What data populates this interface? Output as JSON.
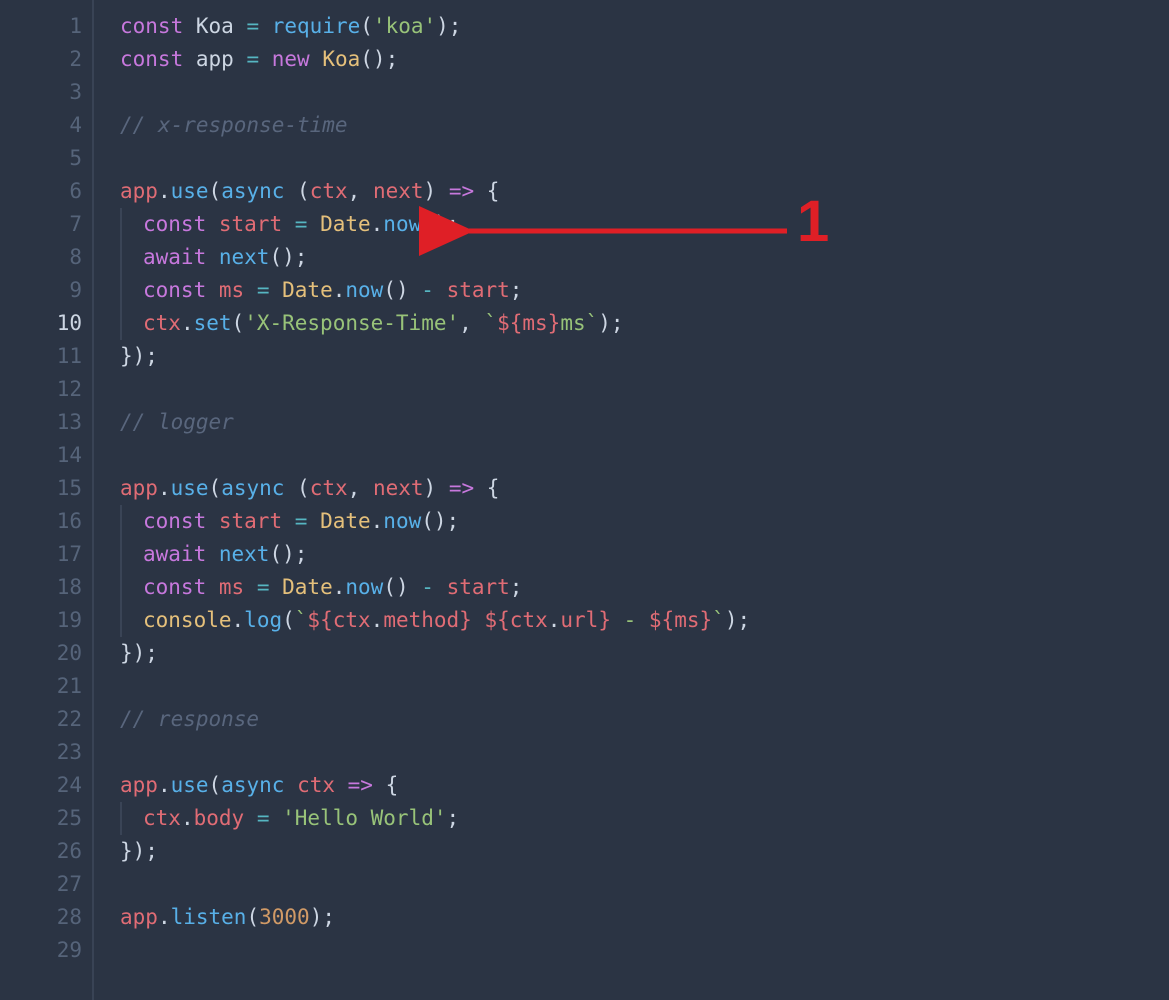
{
  "annotation": {
    "label": "1",
    "color": "#df1f26",
    "target_line": 7
  },
  "line_count": 29,
  "highlight_line_number": 10,
  "code": {
    "lines": [
      {
        "n": 1,
        "tokens": [
          [
            "kw",
            "const"
          ],
          [
            "wd",
            " Koa "
          ],
          [
            "op",
            "="
          ],
          [
            "wd",
            " "
          ],
          [
            "fn",
            "require"
          ],
          [
            "wd",
            "("
          ],
          [
            "str",
            "'koa'"
          ],
          [
            "wd",
            ");"
          ]
        ]
      },
      {
        "n": 2,
        "tokens": [
          [
            "kw",
            "const"
          ],
          [
            "wd",
            " app "
          ],
          [
            "op",
            "="
          ],
          [
            "wd",
            " "
          ],
          [
            "kw",
            "new"
          ],
          [
            "wd",
            " "
          ],
          [
            "cls",
            "Koa"
          ],
          [
            "wd",
            "();"
          ]
        ]
      },
      {
        "n": 3,
        "tokens": []
      },
      {
        "n": 4,
        "tokens": [
          [
            "cmt",
            "// x-response-time"
          ]
        ]
      },
      {
        "n": 5,
        "tokens": []
      },
      {
        "n": 6,
        "tokens": [
          [
            "var",
            "app"
          ],
          [
            "wd",
            "."
          ],
          [
            "fn",
            "use"
          ],
          [
            "wd",
            "("
          ],
          [
            "fn",
            "async"
          ],
          [
            "wd",
            " ("
          ],
          [
            "prm",
            "ctx"
          ],
          [
            "wd",
            ", "
          ],
          [
            "prm",
            "next"
          ],
          [
            "wd",
            ") "
          ],
          [
            "kw",
            "=>"
          ],
          [
            "wd",
            " {"
          ]
        ]
      },
      {
        "n": 7,
        "indent": 1,
        "tokens": [
          [
            "kw",
            "const"
          ],
          [
            "wd",
            " "
          ],
          [
            "var",
            "start"
          ],
          [
            "wd",
            " "
          ],
          [
            "op",
            "="
          ],
          [
            "wd",
            " "
          ],
          [
            "cls",
            "Date"
          ],
          [
            "wd",
            "."
          ],
          [
            "fn",
            "now"
          ],
          [
            "wd",
            "();"
          ]
        ]
      },
      {
        "n": 8,
        "indent": 1,
        "tokens": [
          [
            "kw",
            "await"
          ],
          [
            "wd",
            " "
          ],
          [
            "fn",
            "next"
          ],
          [
            "wd",
            "();"
          ]
        ]
      },
      {
        "n": 9,
        "indent": 1,
        "tokens": [
          [
            "kw",
            "const"
          ],
          [
            "wd",
            " "
          ],
          [
            "var",
            "ms"
          ],
          [
            "wd",
            " "
          ],
          [
            "op",
            "="
          ],
          [
            "wd",
            " "
          ],
          [
            "cls",
            "Date"
          ],
          [
            "wd",
            "."
          ],
          [
            "fn",
            "now"
          ],
          [
            "wd",
            "() "
          ],
          [
            "op",
            "-"
          ],
          [
            "wd",
            " "
          ],
          [
            "var",
            "start"
          ],
          [
            "wd",
            ";"
          ]
        ]
      },
      {
        "n": 10,
        "indent": 1,
        "tokens": [
          [
            "var",
            "ctx"
          ],
          [
            "wd",
            "."
          ],
          [
            "fn",
            "set"
          ],
          [
            "wd",
            "("
          ],
          [
            "str",
            "'X-Response-Time'"
          ],
          [
            "wd",
            ", "
          ],
          [
            "str",
            "`"
          ],
          [
            "tpl",
            "${"
          ],
          [
            "var",
            "ms"
          ],
          [
            "tpl",
            "}"
          ],
          [
            "str",
            "ms`"
          ],
          [
            "wd",
            ");"
          ]
        ]
      },
      {
        "n": 11,
        "tokens": [
          [
            "wd",
            "});"
          ]
        ]
      },
      {
        "n": 12,
        "tokens": []
      },
      {
        "n": 13,
        "tokens": [
          [
            "cmt",
            "// logger"
          ]
        ]
      },
      {
        "n": 14,
        "tokens": []
      },
      {
        "n": 15,
        "tokens": [
          [
            "var",
            "app"
          ],
          [
            "wd",
            "."
          ],
          [
            "fn",
            "use"
          ],
          [
            "wd",
            "("
          ],
          [
            "fn",
            "async"
          ],
          [
            "wd",
            " ("
          ],
          [
            "prm",
            "ctx"
          ],
          [
            "wd",
            ", "
          ],
          [
            "prm",
            "next"
          ],
          [
            "wd",
            ") "
          ],
          [
            "kw",
            "=>"
          ],
          [
            "wd",
            " {"
          ]
        ]
      },
      {
        "n": 16,
        "indent": 1,
        "tokens": [
          [
            "kw",
            "const"
          ],
          [
            "wd",
            " "
          ],
          [
            "var",
            "start"
          ],
          [
            "wd",
            " "
          ],
          [
            "op",
            "="
          ],
          [
            "wd",
            " "
          ],
          [
            "cls",
            "Date"
          ],
          [
            "wd",
            "."
          ],
          [
            "fn",
            "now"
          ],
          [
            "wd",
            "();"
          ]
        ]
      },
      {
        "n": 17,
        "indent": 1,
        "tokens": [
          [
            "kw",
            "await"
          ],
          [
            "wd",
            " "
          ],
          [
            "fn",
            "next"
          ],
          [
            "wd",
            "();"
          ]
        ]
      },
      {
        "n": 18,
        "indent": 1,
        "tokens": [
          [
            "kw",
            "const"
          ],
          [
            "wd",
            " "
          ],
          [
            "var",
            "ms"
          ],
          [
            "wd",
            " "
          ],
          [
            "op",
            "="
          ],
          [
            "wd",
            " "
          ],
          [
            "cls",
            "Date"
          ],
          [
            "wd",
            "."
          ],
          [
            "fn",
            "now"
          ],
          [
            "wd",
            "() "
          ],
          [
            "op",
            "-"
          ],
          [
            "wd",
            " "
          ],
          [
            "var",
            "start"
          ],
          [
            "wd",
            ";"
          ]
        ]
      },
      {
        "n": 19,
        "indent": 1,
        "tokens": [
          [
            "cls",
            "console"
          ],
          [
            "wd",
            "."
          ],
          [
            "fn",
            "log"
          ],
          [
            "wd",
            "("
          ],
          [
            "str",
            "`"
          ],
          [
            "tpl",
            "${"
          ],
          [
            "var",
            "ctx"
          ],
          [
            "wd",
            "."
          ],
          [
            "var",
            "method"
          ],
          [
            "tpl",
            "}"
          ],
          [
            "str",
            " "
          ],
          [
            "tpl",
            "${"
          ],
          [
            "var",
            "ctx"
          ],
          [
            "wd",
            "."
          ],
          [
            "var",
            "url"
          ],
          [
            "tpl",
            "}"
          ],
          [
            "str",
            " - "
          ],
          [
            "tpl",
            "${"
          ],
          [
            "var",
            "ms"
          ],
          [
            "tpl",
            "}"
          ],
          [
            "str",
            "`"
          ],
          [
            "wd",
            ");"
          ]
        ]
      },
      {
        "n": 20,
        "tokens": [
          [
            "wd",
            "});"
          ]
        ]
      },
      {
        "n": 21,
        "tokens": []
      },
      {
        "n": 22,
        "tokens": [
          [
            "cmt",
            "// response"
          ]
        ]
      },
      {
        "n": 23,
        "tokens": []
      },
      {
        "n": 24,
        "tokens": [
          [
            "var",
            "app"
          ],
          [
            "wd",
            "."
          ],
          [
            "fn",
            "use"
          ],
          [
            "wd",
            "("
          ],
          [
            "fn",
            "async"
          ],
          [
            "wd",
            " "
          ],
          [
            "prm",
            "ctx"
          ],
          [
            "wd",
            " "
          ],
          [
            "kw",
            "=>"
          ],
          [
            "wd",
            " {"
          ]
        ]
      },
      {
        "n": 25,
        "indent": 1,
        "tokens": [
          [
            "var",
            "ctx"
          ],
          [
            "wd",
            "."
          ],
          [
            "var",
            "body"
          ],
          [
            "wd",
            " "
          ],
          [
            "op",
            "="
          ],
          [
            "wd",
            " "
          ],
          [
            "str",
            "'Hello World'"
          ],
          [
            "wd",
            ";"
          ]
        ]
      },
      {
        "n": 26,
        "tokens": [
          [
            "wd",
            "});"
          ]
        ]
      },
      {
        "n": 27,
        "tokens": []
      },
      {
        "n": 28,
        "tokens": [
          [
            "var",
            "app"
          ],
          [
            "wd",
            "."
          ],
          [
            "fn",
            "listen"
          ],
          [
            "wd",
            "("
          ],
          [
            "num",
            "3000"
          ],
          [
            "wd",
            ");"
          ]
        ]
      },
      {
        "n": 29,
        "tokens": []
      }
    ]
  }
}
